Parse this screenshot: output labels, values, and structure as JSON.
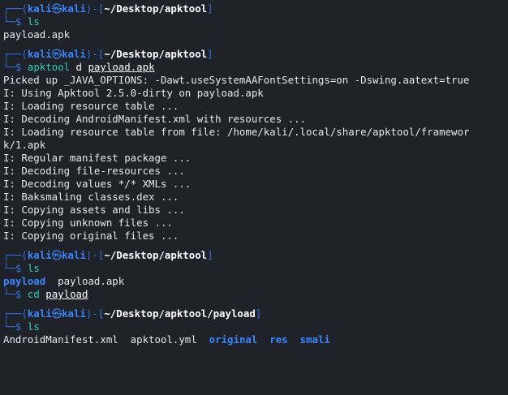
{
  "prompt": {
    "user": "kali",
    "symbol": "㉿",
    "host": "kali",
    "frame_top_left": "┌──(",
    "frame_mid": ")-[",
    "frame_close": "]",
    "frame_bottom": "└─$"
  },
  "blocks": [
    {
      "path": "~/Desktop/apktool",
      "command": "ls",
      "args": "",
      "output": [
        "payload.apk"
      ]
    },
    {
      "path": "~/Desktop/apktool",
      "command": "apktool",
      "args_plain": "d",
      "args_underlined": "payload.apk",
      "output": [
        "Picked up _JAVA_OPTIONS: -Dawt.useSystemAAFontSettings=on -Dswing.aatext=true",
        "I: Using Apktool 2.5.0-dirty on payload.apk",
        "I: Loading resource table ...",
        "I: Decoding AndroidManifest.xml with resources ...",
        "I: Loading resource table from file: /home/kali/.local/share/apktool/framewor",
        "k/1.apk",
        "I: Regular manifest package ...",
        "I: Decoding file-resources ...",
        "I: Decoding values */* XMLs ...",
        "I: Baksmaling classes.dex ...",
        "I: Copying assets and libs ...",
        "I: Copying unknown files ...",
        "I: Copying original files ..."
      ]
    },
    {
      "path": "~/Desktop/apktool",
      "command": "ls",
      "output_dirs": [
        "payload"
      ],
      "output_files": [
        "payload.apk"
      ]
    },
    {
      "command": "cd",
      "args_underlined": "payload"
    },
    {
      "path": "~/Desktop/apktool/payload",
      "command": "ls",
      "output_files": [
        "AndroidManifest.xml",
        "apktool.yml"
      ],
      "output_dirs": [
        "original",
        "res",
        "smali"
      ]
    }
  ],
  "colors": {
    "background": "#1f2229",
    "frame": "#2f6fe0",
    "user": "#3a86ff",
    "command": "#2fd2b4",
    "directory": "#3a86ff",
    "text": "#e8e8ec"
  }
}
